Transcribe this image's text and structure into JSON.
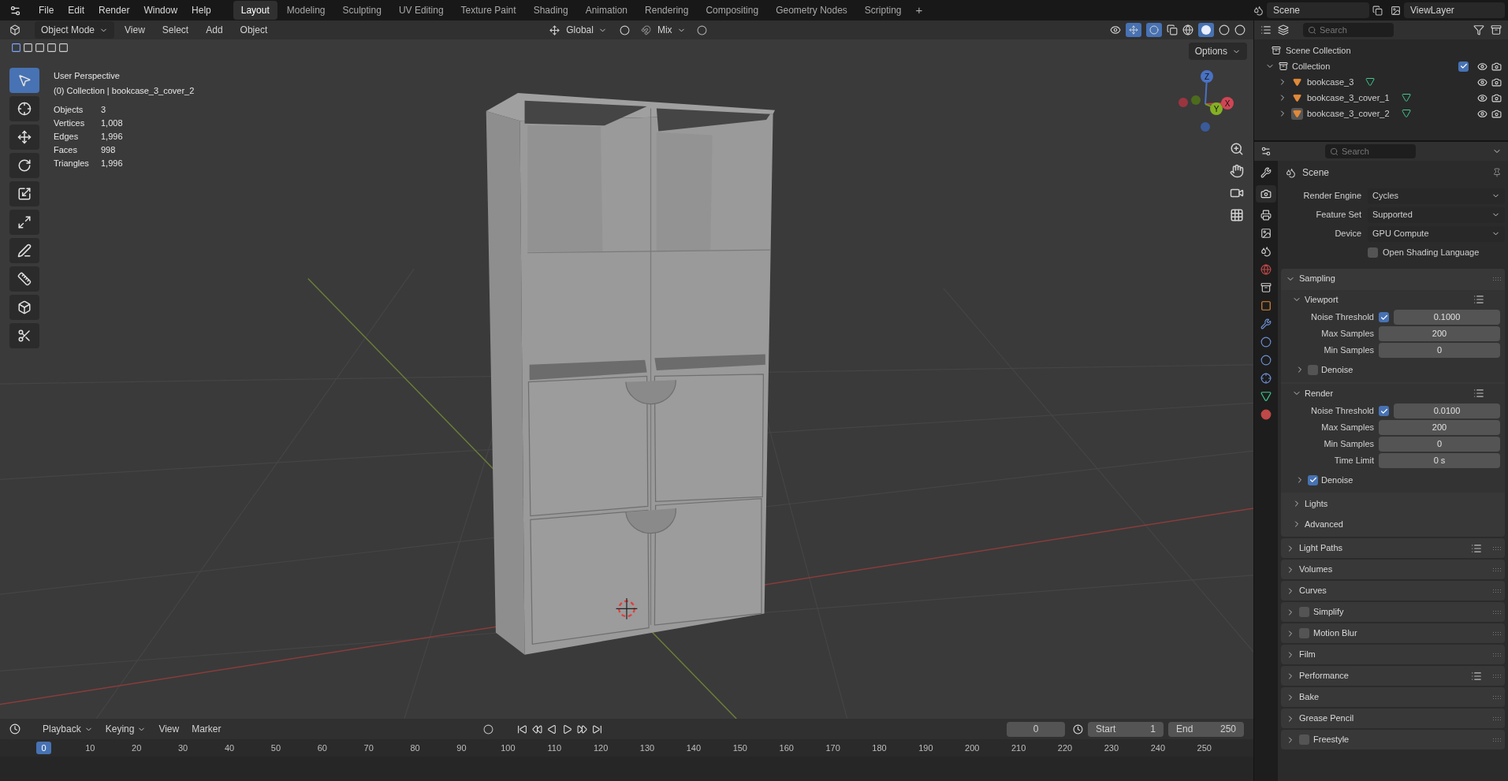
{
  "menu": [
    "File",
    "Edit",
    "Render",
    "Window",
    "Help"
  ],
  "workspaces": [
    {
      "label": "Layout",
      "selected": true
    },
    {
      "label": "Modeling",
      "selected": false
    },
    {
      "label": "Sculpting",
      "selected": false
    },
    {
      "label": "UV Editing",
      "selected": false
    },
    {
      "label": "Texture Paint",
      "selected": false
    },
    {
      "label": "Shading",
      "selected": false
    },
    {
      "label": "Animation",
      "selected": false
    },
    {
      "label": "Rendering",
      "selected": false
    },
    {
      "label": "Compositing",
      "selected": false
    },
    {
      "label": "Geometry Nodes",
      "selected": false
    },
    {
      "label": "Scripting",
      "selected": false
    }
  ],
  "add_workspace": "+",
  "scene": "Scene",
  "view_layer": "ViewLayer",
  "viewport_header": {
    "mode": "Object Mode",
    "menus": [
      "View",
      "Select",
      "Add",
      "Object"
    ],
    "orientation": "Global",
    "snap": "Mix",
    "options": "Options"
  },
  "tools": [
    {
      "kind": "select",
      "selected": true
    },
    {
      "kind": "cursor",
      "selected": false
    },
    {
      "kind": "move",
      "selected": false
    },
    {
      "kind": "rotate",
      "selected": false
    },
    {
      "kind": "scale",
      "selected": false
    },
    {
      "kind": "transform",
      "selected": false
    },
    {
      "kind": "annotate",
      "selected": false
    },
    {
      "kind": "measure",
      "selected": false
    },
    {
      "kind": "add_cube",
      "selected": false
    },
    {
      "kind": "cut",
      "selected": false
    }
  ],
  "overlay": {
    "view": "User Perspective",
    "context": "(0) Collection | bookcase_3_cover_2",
    "stats": [
      {
        "label": "Objects",
        "value": "3"
      },
      {
        "label": "Vertices",
        "value": "1,008"
      },
      {
        "label": "Edges",
        "value": "1,996"
      },
      {
        "label": "Faces",
        "value": "998"
      },
      {
        "label": "Triangles",
        "value": "1,996"
      }
    ]
  },
  "gizmo": {
    "x": "X",
    "y": "Y",
    "z": "Z"
  },
  "outliner": {
    "search_placeholder": "Search",
    "tree": {
      "label": "Scene Collection",
      "children": [
        {
          "label": "Collection",
          "expanded": true,
          "checked": true,
          "children": [
            {
              "label": "bookcase_3",
              "expanded": false,
              "active": false
            },
            {
              "label": "bookcase_3_cover_1",
              "expanded": false,
              "active": false
            },
            {
              "label": "bookcase_3_cover_2",
              "expanded": false,
              "active": true
            }
          ]
        }
      ]
    }
  },
  "properties": {
    "search_placeholder": "Search",
    "context": "Scene",
    "fields": [
      {
        "kind": "select",
        "label": "Render Engine",
        "value": "Cycles"
      },
      {
        "kind": "select",
        "label": "Feature Set",
        "value": "Supported"
      },
      {
        "kind": "select",
        "label": "Device",
        "value": "GPU Compute"
      },
      {
        "kind": "checkbox",
        "label": "Open Shading Language",
        "checked": false
      }
    ],
    "panels": [
      {
        "kind": "panel",
        "label": "Sampling",
        "expanded": true,
        "presets": false,
        "children": [
          {
            "kind": "subpanel",
            "label": "Viewport",
            "expanded": true,
            "presets": true,
            "children": [
              {
                "kind": "toggled_number",
                "label": "Noise Threshold",
                "checked": true,
                "value": "0.1000"
              },
              {
                "kind": "number",
                "label": "Max Samples",
                "value": "200"
              },
              {
                "kind": "number",
                "label": "Min Samples",
                "value": "0"
              },
              {
                "kind": "toggle_subpanel",
                "label": "Denoise",
                "expanded": false,
                "checked": false
              }
            ]
          },
          {
            "kind": "subpanel",
            "label": "Render",
            "expanded": true,
            "presets": true,
            "children": [
              {
                "kind": "toggled_number",
                "label": "Noise Threshold",
                "checked": true,
                "value": "0.0100"
              },
              {
                "kind": "number",
                "label": "Max Samples",
                "value": "200"
              },
              {
                "kind": "number",
                "label": "Min Samples",
                "value": "0"
              },
              {
                "kind": "number",
                "label": "Time Limit",
                "value": "0 s"
              },
              {
                "kind": "toggle_subpanel",
                "label": "Denoise",
                "expanded": false,
                "checked": true
              }
            ]
          },
          {
            "kind": "subpanel",
            "label": "Lights",
            "expanded": false,
            "presets": false
          },
          {
            "kind": "subpanel",
            "label": "Advanced",
            "expanded": false,
            "presets": false
          }
        ]
      },
      {
        "kind": "panel",
        "label": "Light Paths",
        "expanded": false,
        "presets": true
      },
      {
        "kind": "panel",
        "label": "Volumes",
        "expanded": false,
        "presets": false
      },
      {
        "kind": "panel",
        "label": "Curves",
        "expanded": false,
        "presets": false
      },
      {
        "kind": "toggle_panel",
        "label": "Simplify",
        "expanded": false,
        "checked": false
      },
      {
        "kind": "toggle_panel",
        "label": "Motion Blur",
        "expanded": false,
        "checked": false
      },
      {
        "kind": "panel",
        "label": "Film",
        "expanded": false,
        "presets": false
      },
      {
        "kind": "panel",
        "label": "Performance",
        "expanded": false,
        "presets": true
      },
      {
        "kind": "panel",
        "label": "Bake",
        "expanded": false,
        "presets": false
      },
      {
        "kind": "panel",
        "label": "Grease Pencil",
        "expanded": false,
        "presets": false
      },
      {
        "kind": "toggle_panel",
        "label": "Freestyle",
        "expanded": false,
        "checked": false
      }
    ]
  },
  "timeline": {
    "menus": [
      "Playback",
      "Keying",
      "View",
      "Marker"
    ],
    "current_frame": "0",
    "start_label": "Start",
    "start": "1",
    "end_label": "End",
    "end": "250",
    "playhead": "0",
    "ruler": [
      "10",
      "20",
      "30",
      "40",
      "50",
      "60",
      "70",
      "80",
      "90",
      "100",
      "110",
      "120",
      "130",
      "140",
      "150",
      "160",
      "170",
      "180",
      "190",
      "200",
      "210",
      "220",
      "230",
      "240",
      "250"
    ]
  }
}
